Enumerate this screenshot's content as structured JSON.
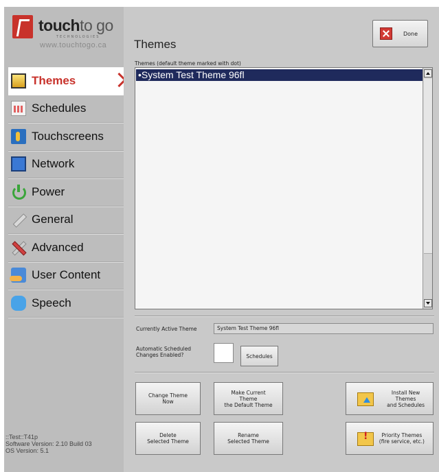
{
  "logo": {
    "brand_bold": "touch",
    "brand_light": "to go",
    "tagline": "TECHNOLOGIES",
    "url": "www.touchtogo.ca"
  },
  "sidebar": {
    "items": [
      {
        "label": "Themes",
        "icon": "themes-icon",
        "active": true
      },
      {
        "label": "Schedules",
        "icon": "calendar-icon"
      },
      {
        "label": "Touchscreens",
        "icon": "touchscreen-icon"
      },
      {
        "label": "Network",
        "icon": "monitor-icon"
      },
      {
        "label": "Power",
        "icon": "power-icon"
      },
      {
        "label": "General",
        "icon": "wrench-icon"
      },
      {
        "label": "Advanced",
        "icon": "tools-icon"
      },
      {
        "label": "User Content",
        "icon": "user-content-icon"
      },
      {
        "label": "Speech",
        "icon": "speech-bubble-icon"
      }
    ],
    "footer": {
      "line1": "::Test::T41p",
      "line2": "Software Version: 2.10 Build 03",
      "line3": "OS Version: 5.1"
    }
  },
  "main": {
    "title": "Themes",
    "done_label": "Done",
    "list_caption": "Themes   (default theme marked with dot)",
    "themes": [
      "•System Test Theme 96fl"
    ],
    "active_theme_label": "Currently Active Theme",
    "active_theme_value": "System Test Theme 96fl",
    "auto_sched_label": "Automatic Scheduled\nChanges Enabled?",
    "schedules_button": "Schedules",
    "buttons": {
      "change_theme": "Change Theme\nNow",
      "make_default": "Make Current\nTheme\nthe Default Theme",
      "install": "Install New\nThemes\nand Schedules",
      "delete": "Delete\nSelected Theme",
      "rename": "Rename\nSelected Theme",
      "priority": "Priority Themes\n(fire service, etc.)"
    }
  },
  "colors": {
    "accent": "#c8322b",
    "selection": "#1f2a5c",
    "background": "#c9c9c9"
  }
}
